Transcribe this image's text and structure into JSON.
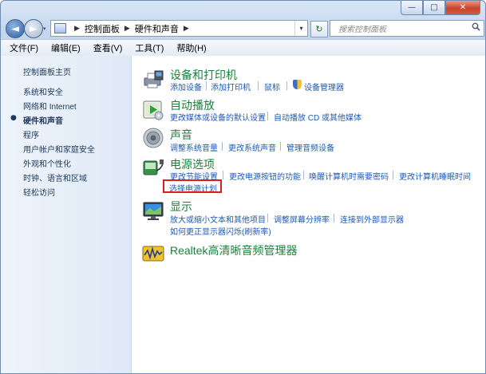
{
  "window": {
    "caption": {
      "minimize": "—",
      "maximize": "□",
      "close": "✕"
    }
  },
  "nav": {
    "back": "◄",
    "forward": "►",
    "recent": "▾",
    "breadcrumb": [
      "控制面板",
      "硬件和声音"
    ],
    "sep": "▶",
    "dropdown": "▾",
    "refresh": "↻",
    "search_placeholder": "搜索控制面板",
    "search_icon": "magnifier-icon"
  },
  "menu": [
    "文件(F)",
    "编辑(E)",
    "查看(V)",
    "工具(T)",
    "帮助(H)"
  ],
  "sidebar": {
    "home": "控制面板主页",
    "items": [
      "系统和安全",
      "网络和 Internet",
      "硬件和声音",
      "程序",
      "用户帐户和家庭安全",
      "外观和个性化",
      "时钟、语言和区域",
      "轻松访问"
    ],
    "current_index": 2,
    "current_marker": "●"
  },
  "categories": {
    "devices": {
      "title": "设备和打印机",
      "icon": "printer-icon",
      "links": [
        "添加设备",
        "添加打印机",
        "鼠标",
        "设备管理器"
      ]
    },
    "autoplay": {
      "title": "自动播放",
      "icon": "autoplay-icon",
      "links": [
        "更改媒体或设备的默认设置",
        "自动播放 CD 或其他媒体"
      ]
    },
    "sound": {
      "title": "声音",
      "icon": "speaker-icon",
      "links": [
        "调整系统音量",
        "更改系统声音",
        "管理音频设备"
      ]
    },
    "power": {
      "title": "电源选项",
      "icon": "power-icon",
      "links": [
        "更改节能设置",
        "更改电源按钮的功能",
        "唤醒计算机时需要密码",
        "更改计算机睡眠时间",
        "选择电源计划"
      ]
    },
    "display": {
      "title": "显示",
      "icon": "monitor-icon",
      "links": [
        "放大或缩小文本和其他项目",
        "调整屏幕分辨率",
        "连接到外部显示器",
        "如何更正显示器闪烁(刷新率)"
      ]
    },
    "realtek": {
      "title": "Realtek高清晰音频管理器",
      "icon": "realtek-audio-icon"
    }
  },
  "colors": {
    "category_title": "#1e7f3a",
    "link": "#1c5ab8",
    "highlight_box": "#e01d1d"
  }
}
